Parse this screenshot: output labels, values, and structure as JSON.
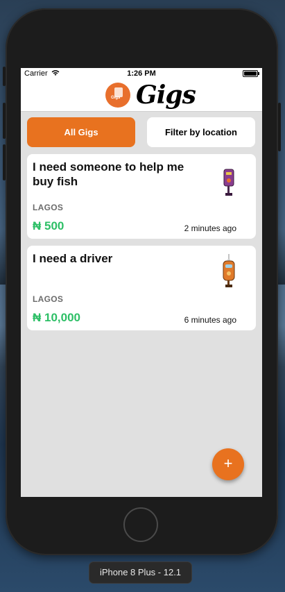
{
  "status_bar": {
    "carrier": "Carrier",
    "time": "1:26 PM"
  },
  "header": {
    "logo_text": "Gigs",
    "logo_mini": "Gigs"
  },
  "tabs": [
    {
      "label": "All Gigs",
      "active": true
    },
    {
      "label": "Filter by location",
      "active": false
    }
  ],
  "gigs": [
    {
      "title": "I need someone to help me buy fish",
      "location": "LAGOS",
      "price": "₦ 500",
      "time": "2 minutes ago",
      "icon": "purple-robot-icon"
    },
    {
      "title": "I need a driver",
      "location": "LAGOS",
      "price": "₦ 10,000",
      "time": "6 minutes ago",
      "icon": "orange-robot-icon"
    }
  ],
  "fab": {
    "label": "+"
  },
  "device_label": "iPhone 8 Plus - 12.1",
  "colors": {
    "accent": "#e8721f",
    "price": "#2dbf66",
    "background": "#e0e0e0"
  }
}
